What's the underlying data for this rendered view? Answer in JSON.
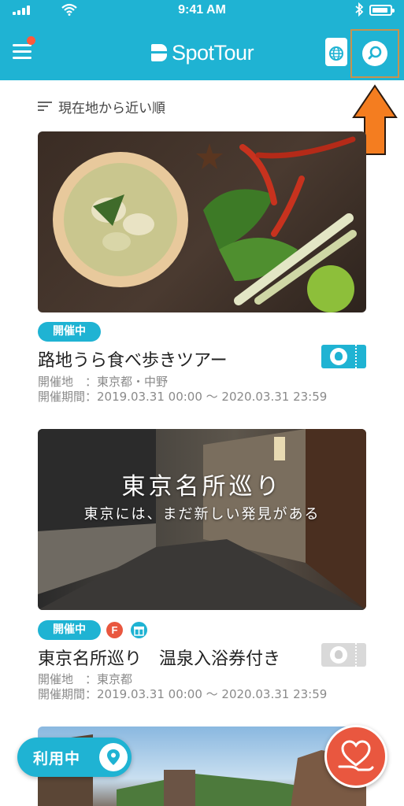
{
  "status_bar": {
    "time": "9:41 AM"
  },
  "header": {
    "app_name": "SpotTour"
  },
  "sort": {
    "label": "現在地から近い順"
  },
  "cards": [
    {
      "status_badge": "開催中",
      "title": "路地うら食べ歩きツアー",
      "location_line": "開催地　：東京都・中野",
      "period_line": "開催期間：2019.03.31 00:00 〜 2020.03.31 23:59",
      "ticket_state": "active"
    },
    {
      "status_badge": "開催中",
      "image_title": "東京名所巡り",
      "image_subtitle": "東京には、まだ新しい発見がある",
      "extra_badges": [
        {
          "text": "F",
          "color": "#e9573f"
        },
        {
          "icon": "gift-icon",
          "color": "#1fb3d3"
        }
      ],
      "title": "東京名所巡り　温泉入浴券付き",
      "location_line": "開催地　：東京都",
      "period_line": "開催期間：2019.03.31 00:00 〜 2020.03.31 23:59",
      "ticket_state": "inactive"
    }
  ],
  "floating": {
    "in_use_label": "利用中"
  },
  "colors": {
    "primary": "#1fb3d3",
    "accent": "#e9573f",
    "annotation": "#f47d20"
  },
  "icons": [
    "menu-icon",
    "globe-passport-icon",
    "search-icon",
    "sort-icon",
    "ticket-icon",
    "gift-icon",
    "map-pin-icon",
    "heart-hand-icon"
  ]
}
